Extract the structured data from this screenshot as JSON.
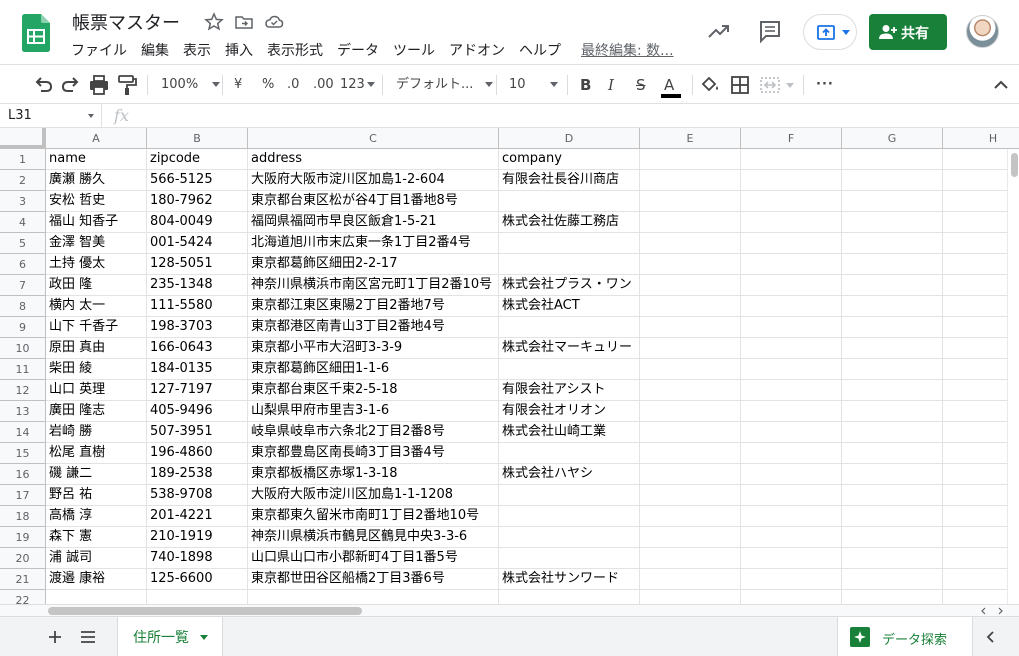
{
  "header": {
    "title": "帳票マスター",
    "menus": [
      "ファイル",
      "編集",
      "表示",
      "挿入",
      "表示形式",
      "データ",
      "ツール",
      "アドオン",
      "ヘルプ"
    ],
    "last_edit": "最終編集: 数...",
    "share_label": "共有"
  },
  "toolbar": {
    "zoom": "100%",
    "currency": "¥",
    "percent": "%",
    "decimal_decrease": ".0",
    "decimal_increase": ".00",
    "number_format": "123",
    "font": "デフォルト...",
    "font_size": "10",
    "bold": "B",
    "italic": "I",
    "strike": "S",
    "text_color": "A",
    "more": "···"
  },
  "formula_bar": {
    "cell_ref": "L31",
    "fx": "fx"
  },
  "columns": [
    "A",
    "B",
    "C",
    "D",
    "E",
    "F",
    "G",
    "H"
  ],
  "row_numbers": [
    "1",
    "2",
    "3",
    "4",
    "5",
    "6",
    "7",
    "8",
    "9",
    "10",
    "11",
    "12",
    "13",
    "14",
    "15",
    "16",
    "17",
    "18",
    "19",
    "20",
    "21",
    "22"
  ],
  "rows": [
    [
      "name",
      "zipcode",
      "address",
      "company"
    ],
    [
      "廣瀬 勝久",
      "566-5125",
      "大阪府大阪市淀川区加島1-2-604",
      "有限会社長谷川商店"
    ],
    [
      "安松 哲史",
      "180-7962",
      "東京都台東区松が谷4丁目1番地8号",
      ""
    ],
    [
      "福山 知香子",
      "804-0049",
      "福岡県福岡市早良区飯倉1-5-21",
      "株式会社佐藤工務店"
    ],
    [
      "金澤 智美",
      "001-5424",
      "北海道旭川市末広東一条1丁目2番4号",
      ""
    ],
    [
      "土持 優太",
      "128-5051",
      "東京都葛飾区細田2-2-17",
      ""
    ],
    [
      "政田 隆",
      "235-1348",
      "神奈川県横浜市南区宮元町1丁目2番10号",
      "株式会社プラス・ワン"
    ],
    [
      "横内 太一",
      "111-5580",
      "東京都江東区東陽2丁目2番地7号",
      "株式会社ACT"
    ],
    [
      "山下 千香子",
      "198-3703",
      "東京都港区南青山3丁目2番地4号",
      ""
    ],
    [
      "原田 真由",
      "166-0643",
      "東京都小平市大沼町3-3-9",
      "株式会社マーキュリー"
    ],
    [
      "柴田 綾",
      "184-0135",
      "東京都葛飾区細田1-1-6",
      ""
    ],
    [
      "山口 英理",
      "127-7197",
      "東京都台東区千束2-5-18",
      "有限会社アシスト"
    ],
    [
      "廣田 隆志",
      "405-9496",
      "山梨県甲府市里吉3-1-6",
      "有限会社オリオン"
    ],
    [
      "岩崎 勝",
      "507-3951",
      "岐阜県岐阜市六条北2丁目2番8号",
      "株式会社山崎工業"
    ],
    [
      "松尾 直樹",
      "196-4860",
      "東京都豊島区南長崎3丁目3番4号",
      ""
    ],
    [
      "磯 謙二",
      "189-2538",
      "東京都板橋区赤塚1-3-18",
      "株式会社ハヤシ"
    ],
    [
      "野呂 祐",
      "538-9708",
      "大阪府大阪市淀川区加島1-1-1208",
      ""
    ],
    [
      "高橋 淳",
      "201-4221",
      "東京都東久留米市南町1丁目2番地10号",
      ""
    ],
    [
      "森下 憲",
      "210-1919",
      "神奈川県横浜市鶴見区鶴見中央3-3-6",
      ""
    ],
    [
      "浦 誠司",
      "740-1898",
      "山口県山口市小郡新町4丁目1番5号",
      ""
    ],
    [
      "渡邉 康裕",
      "125-6600",
      "東京都世田谷区船橋2丁目3番6号",
      "株式会社サンワード"
    ],
    [
      "",
      "",
      "",
      ""
    ]
  ],
  "bottom": {
    "sheet_name": "住所一覧",
    "explore_label": "データ探索"
  },
  "colors": {
    "accent_green": "#188038",
    "grid_line": "#e2e3e3",
    "header_bg": "#f8f9fa"
  }
}
